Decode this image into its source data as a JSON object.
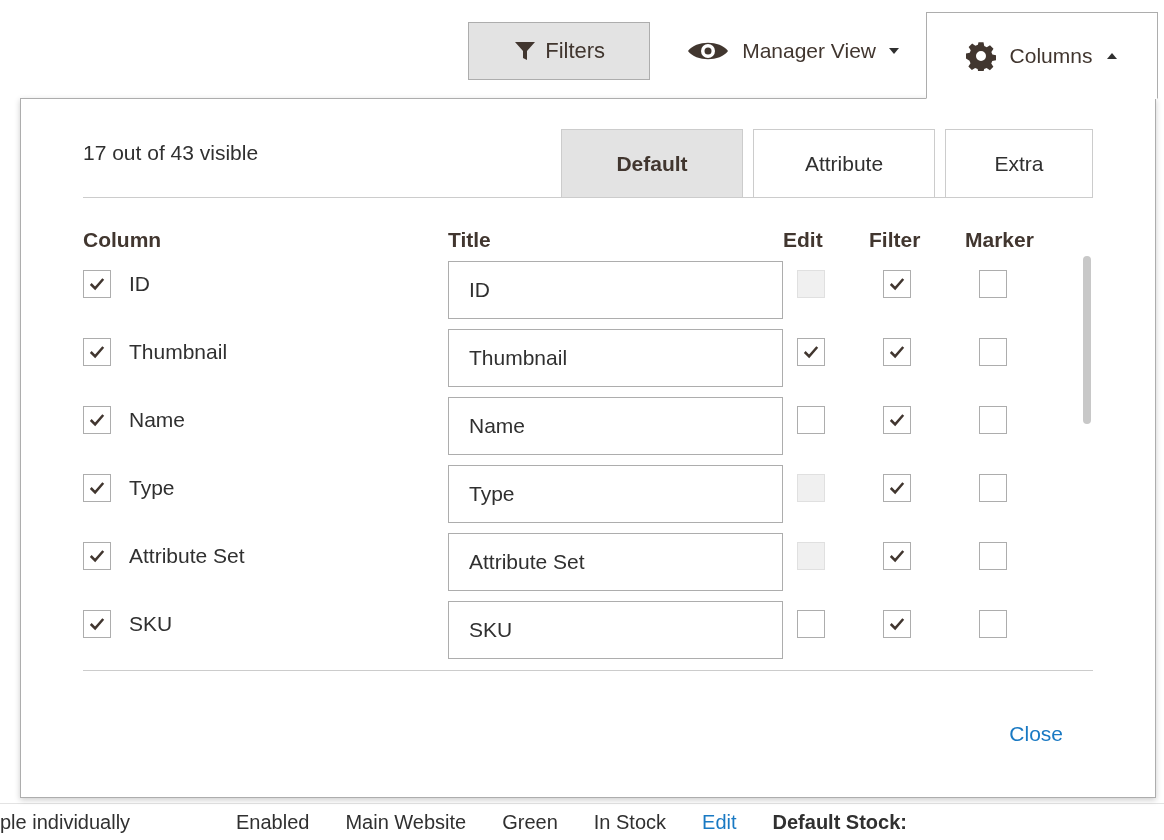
{
  "toolbar": {
    "filters_button": "Filters",
    "view_switcher": {
      "label": "Manager View",
      "expanded": false
    },
    "columns_button": {
      "label": "Columns",
      "expanded": true
    }
  },
  "columns_panel": {
    "summary": "17 out of 43 visible",
    "tabs": [
      {
        "label": "Default",
        "selected": true
      },
      {
        "label": "Attribute",
        "selected": false
      },
      {
        "label": "Extra",
        "selected": false
      }
    ],
    "headers": [
      "Column",
      "Title",
      "Edit",
      "Filter",
      "Marker"
    ],
    "rows": [
      {
        "column": "ID",
        "visible": true,
        "title": "ID",
        "edit": {
          "checked": false,
          "disabled": true
        },
        "filter": true,
        "marker": false
      },
      {
        "column": "Thumbnail",
        "visible": true,
        "title": "Thumbnail",
        "edit": {
          "checked": true,
          "disabled": false
        },
        "filter": true,
        "marker": false
      },
      {
        "column": "Name",
        "visible": true,
        "title": "Name",
        "edit": {
          "checked": false,
          "disabled": false
        },
        "filter": true,
        "marker": false
      },
      {
        "column": "Type",
        "visible": true,
        "title": "Type",
        "edit": {
          "checked": false,
          "disabled": true
        },
        "filter": true,
        "marker": false
      },
      {
        "column": "Attribute Set",
        "visible": true,
        "title": "Attribute Set",
        "edit": {
          "checked": false,
          "disabled": true
        },
        "filter": true,
        "marker": false
      },
      {
        "column": "SKU",
        "visible": true,
        "title": "SKU",
        "edit": {
          "checked": false,
          "disabled": false
        },
        "filter": true,
        "marker": false
      }
    ],
    "close_link": "Close"
  },
  "grid_row": [
    {
      "text": "ple individually",
      "kind": "text"
    },
    {
      "text": "Enabled",
      "kind": "text"
    },
    {
      "text": "Main Website",
      "kind": "text"
    },
    {
      "text": "Green",
      "kind": "text"
    },
    {
      "text": "In Stock",
      "kind": "text"
    },
    {
      "text": "Edit",
      "kind": "link"
    },
    {
      "text": "Default Stock:",
      "kind": "bold"
    }
  ]
}
